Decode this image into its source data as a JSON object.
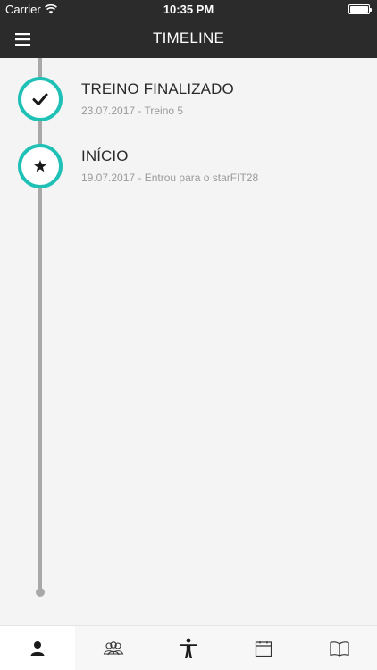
{
  "status_bar": {
    "carrier": "Carrier",
    "time": "10:35 PM"
  },
  "nav": {
    "title": "TIMELINE",
    "menu_icon": "hamburger-menu-icon"
  },
  "accent_color": "#1fc1b6",
  "timeline": {
    "entries": [
      {
        "title": "TREINO FINALIZADO",
        "subtitle": "23.07.2017 - Treino 5",
        "icon": "checkmark-icon"
      },
      {
        "title": "INÍCIO",
        "subtitle": "19.07.2017 - Entrou para o starFIT28",
        "icon": "star-icon"
      }
    ]
  },
  "tab_bar": {
    "tabs": [
      {
        "icon": "person-icon",
        "active": true
      },
      {
        "icon": "group-icon",
        "active": false
      },
      {
        "icon": "body-figure-icon",
        "active": false
      },
      {
        "icon": "calendar-icon",
        "active": false
      },
      {
        "icon": "book-icon",
        "active": false
      }
    ]
  }
}
